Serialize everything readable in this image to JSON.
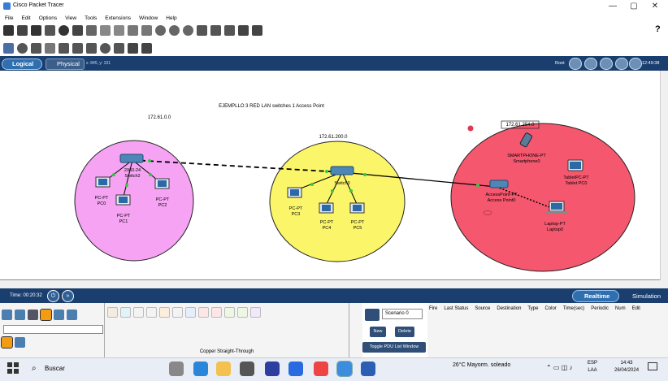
{
  "window": {
    "title": "Cisco Packet Tracer",
    "minimize": "—",
    "maximize": "▢",
    "close": "✕"
  },
  "menu": [
    "File",
    "Edit",
    "Options",
    "View",
    "Tools",
    "Extensions",
    "Window",
    "Help"
  ],
  "toolbar": {
    "help": "?"
  },
  "tabs": {
    "logical": "Logical",
    "physical": "Physical",
    "coords": "x: 845, y: 101",
    "root": "Root",
    "clock": "12:49:38"
  },
  "topology": {
    "title": "EJEMPLLO 3 RED LAN switches 1 Access Point",
    "networks": [
      {
        "label": "172.61.0.0",
        "color": "#f5a3f2"
      },
      {
        "label": "172.61.200.0",
        "color": "#fbf56a"
      },
      {
        "label": "172.61.254.0",
        "color": "#f5576f"
      }
    ],
    "devices": [
      {
        "name": "Switch2",
        "type": "2960-24"
      },
      {
        "name": "PC0",
        "type": "PC-PT"
      },
      {
        "name": "PC1",
        "type": "PC-PT"
      },
      {
        "name": "PC2",
        "type": "PC-PT"
      },
      {
        "name": "Switch3",
        "type": "2960-24"
      },
      {
        "name": "PC3",
        "type": "PC-PT"
      },
      {
        "name": "PC4",
        "type": "PC-PT"
      },
      {
        "name": "PC5",
        "type": "PC-PT"
      },
      {
        "name": "Access Point0",
        "type": "AccessPoint-PT"
      },
      {
        "name": "Smartphone0",
        "type": "SMARTPHONE-PT"
      },
      {
        "name": "Tablet PC0",
        "type": "TabletPC-PT"
      },
      {
        "name": "Laptop0",
        "type": "Laptop-PT"
      }
    ]
  },
  "sim": {
    "time": "Time: 00:20:32",
    "realtime": "Realtime",
    "simulation": "Simulation"
  },
  "palette": {
    "cable_label": "Copper Straight-Through"
  },
  "pdu": {
    "scenario": "Scenario 0",
    "new": "New",
    "delete": "Delete",
    "toggle": "Toggle PDU List Window"
  },
  "pdu_columns": [
    "Fire",
    "Last Status",
    "Source",
    "Destination",
    "Type",
    "Color",
    "Time(sec)",
    "Periodic",
    "Num",
    "Edit"
  ],
  "taskbar": {
    "search": "Buscar",
    "weather": "26°C  Mayorm. soleado",
    "lang1": "ESP",
    "lang2": "LAA",
    "time": "14:43",
    "date": "26/04/2024"
  }
}
